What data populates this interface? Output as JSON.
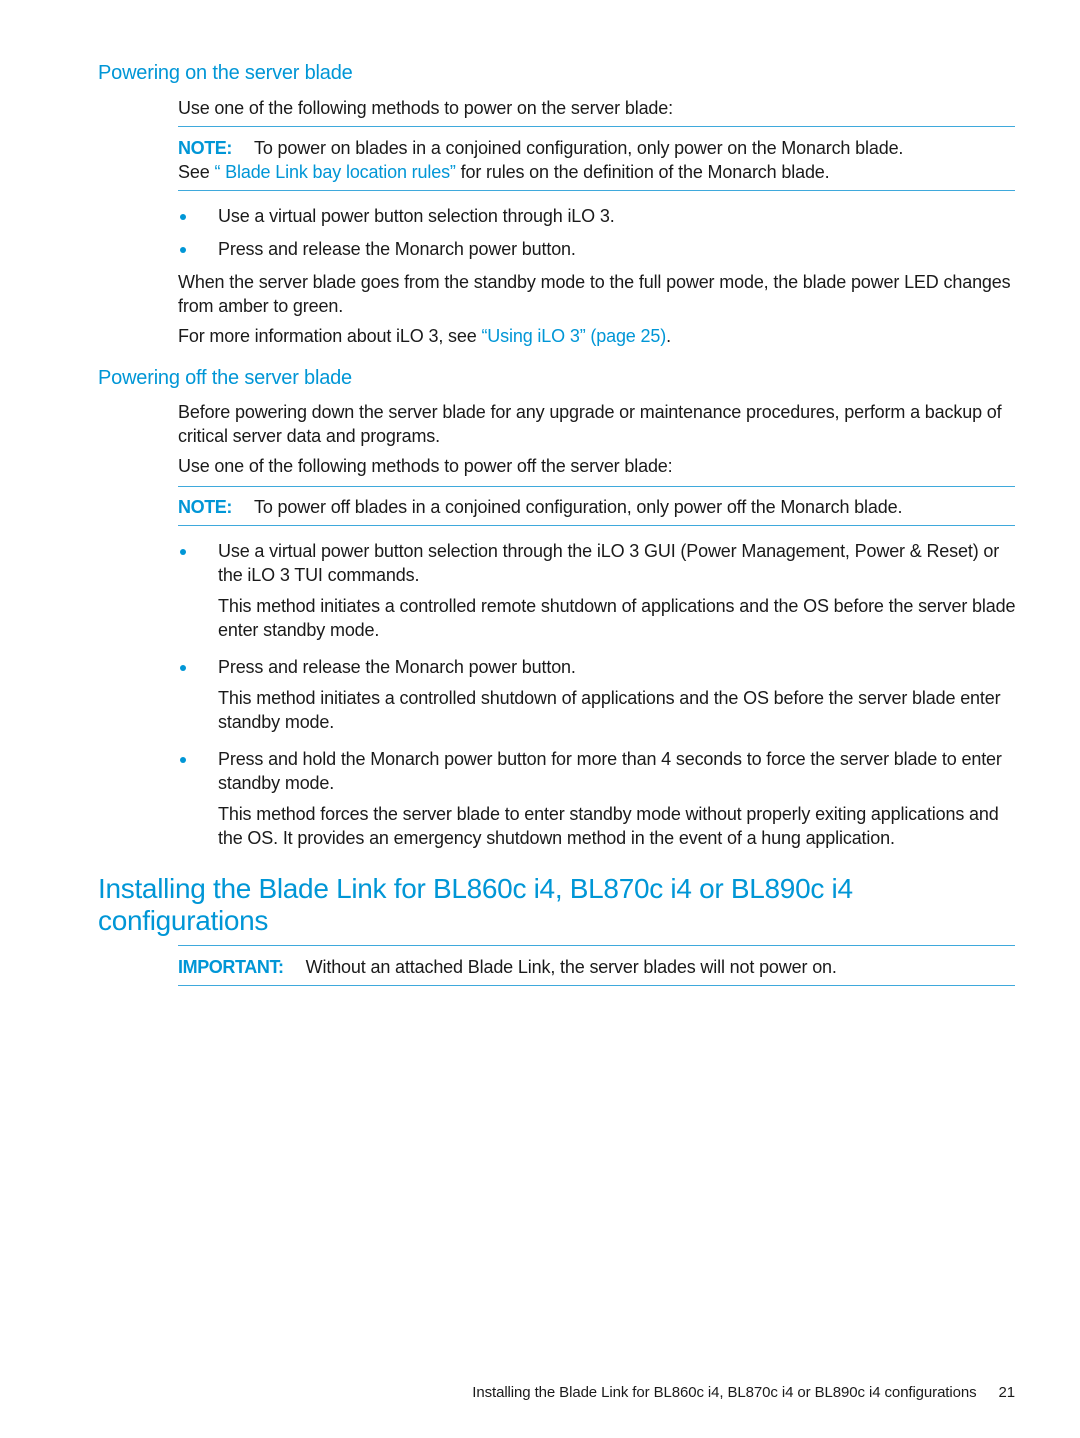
{
  "section_on": {
    "heading": "Powering on the server blade",
    "intro": "Use one of the following methods to power on the server blade:",
    "note": {
      "label": "NOTE:",
      "text_1": "To power on blades in a conjoined configuration, only power on the Monarch blade.",
      "text_2_prefix": "See ",
      "link": "“ Blade Link bay location rules”",
      "text_2_suffix": " for rules on the definition of the Monarch blade."
    },
    "bullets": [
      "Use a virtual power button selection through iLO 3.",
      "Press and release the Monarch power button."
    ],
    "para_1": "When the server blade goes from the standby mode to the full power mode, the blade power LED changes from amber to green.",
    "para_2_prefix": "For more information about iLO 3, see ",
    "para_2_link": "“Using iLO 3” (page 25)",
    "para_2_suffix": "."
  },
  "section_off": {
    "heading": "Powering off the server blade",
    "intro_1": "Before powering down the server blade for any upgrade or maintenance procedures, perform a backup of critical server data and programs.",
    "intro_2": "Use one of the following methods to power off the server blade:",
    "note": {
      "label": "NOTE:",
      "text": "To power off blades in a conjoined configuration, only power off the Monarch blade."
    },
    "bullets": [
      {
        "text": "Use a virtual power button selection through the iLO 3 GUI (Power Management, Power & Reset) or the iLO 3 TUI commands.",
        "detail": "This method initiates a controlled remote shutdown of applications and the OS before the server blade enter standby mode."
      },
      {
        "text": "Press and release the Monarch power button.",
        "detail": "This method initiates a controlled shutdown of applications and the OS before the server blade enter standby mode."
      },
      {
        "text": "Press and hold the Monarch power button for more than 4 seconds to force the server blade to enter standby mode.",
        "detail": "This method forces the server blade to enter standby mode without properly exiting applications and the OS. It provides an emergency shutdown method in the event of a hung application."
      }
    ]
  },
  "section_install": {
    "heading": "Installing the Blade Link for BL860c i4, BL870c i4 or BL890c i4 configurations",
    "important": {
      "label": "IMPORTANT:",
      "text": "Without an attached Blade Link, the server blades will not power on."
    }
  },
  "footer": {
    "title": "Installing the Blade Link for BL860c i4, BL870c i4 or BL890c i4 configurations",
    "page_number": "21"
  },
  "colors": {
    "accent": "#0096d6",
    "rule": "#3fa9dc",
    "text": "#1a1a1a"
  }
}
